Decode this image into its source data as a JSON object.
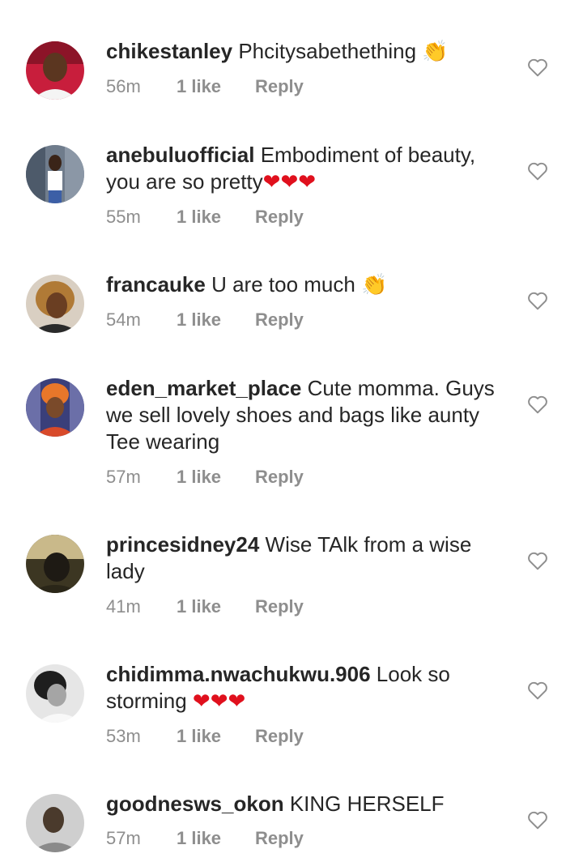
{
  "comments": [
    {
      "username": "chikestanley",
      "text": "Phcitysabethething ",
      "emojis": [
        "👏"
      ],
      "time": "56m",
      "likes": "1 like",
      "reply": "Reply"
    },
    {
      "username": "anebuluofficial",
      "text": "Embodiment of beauty, you are so pretty",
      "emojis": [
        "❤",
        "❤",
        "❤"
      ],
      "time": "55m",
      "likes": "1 like",
      "reply": "Reply"
    },
    {
      "username": "francauke",
      "text": "U are too much ",
      "emojis": [
        "👏"
      ],
      "time": "54m",
      "likes": "1 like",
      "reply": "Reply"
    },
    {
      "username": "eden_market_place",
      "text": "Cute momma. Guys we sell lovely shoes and bags like aunty Tee wearing",
      "emojis": [],
      "time": "57m",
      "likes": "1 like",
      "reply": "Reply"
    },
    {
      "username": "princesidney24",
      "text": "Wise TAlk from a wise lady",
      "emojis": [],
      "time": "41m",
      "likes": "1 like",
      "reply": "Reply"
    },
    {
      "username": "chidimma.nwachukwu.906",
      "text": "Look so storming ",
      "emojis": [
        "❤",
        "❤",
        "❤"
      ],
      "time": "53m",
      "likes": "1 like",
      "reply": "Reply"
    },
    {
      "username": "goodnesws_okon",
      "text": "KING HERSELF",
      "emojis": [],
      "time": "57m",
      "likes": "1 like",
      "reply": "Reply"
    }
  ],
  "icons": {
    "like": "heart-outline-icon",
    "clap": "clapping-hands-emoji",
    "heart": "red-heart-emoji"
  },
  "colors": {
    "text": "#262626",
    "meta": "#8e8e8e",
    "heart_emoji": "#e0101d"
  }
}
